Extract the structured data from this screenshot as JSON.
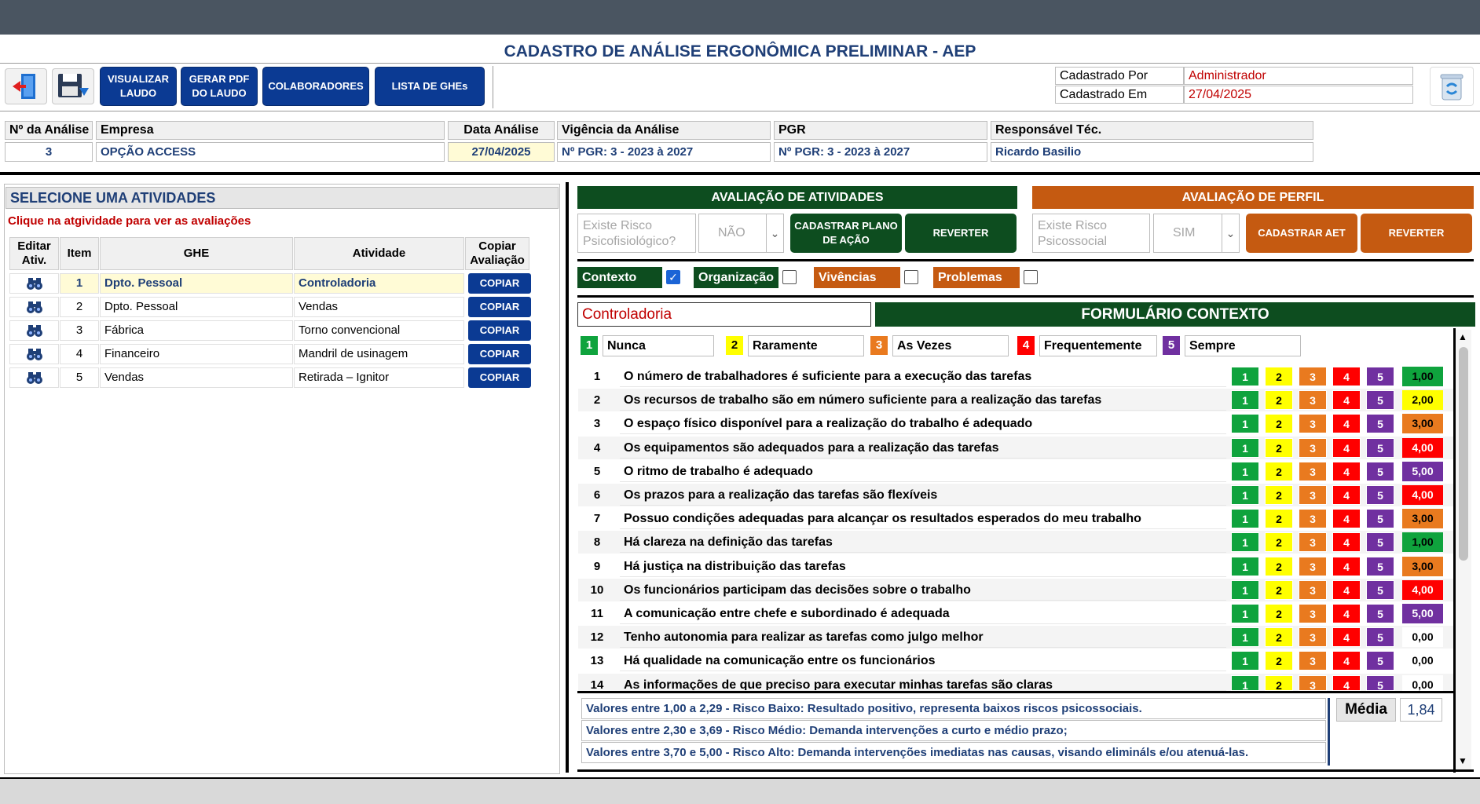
{
  "form_title": "CADASTRO DE ANÁLISE ERGONÔMICA PRELIMINAR - AEP",
  "toolbar": {
    "exit_icon": "exit-door-icon",
    "save_icon": "save-disk-icon",
    "view_report": "VISUALIZAR LAUDO",
    "generate_pdf": "GERAR PDF DO LAUDO",
    "collaborators": "COLABORADORES",
    "ghe_list": "LISTA DE GHEs",
    "trash_icon": "trash-icon"
  },
  "registration": {
    "by_label": "Cadastrado Por",
    "by_value": "Administrador",
    "on_label": "Cadastrado Em",
    "on_value": "27/04/2025"
  },
  "header": {
    "labels": {
      "analysis_no": "Nº da Análise",
      "company": "Empresa",
      "analysis_date": "Data Análise",
      "validity": "Vigência da Análise",
      "pgr": "PGR",
      "responsible": "Responsável Téc."
    },
    "values": {
      "analysis_no": "3",
      "company": "OPÇÃO ACCESS",
      "analysis_date": "27/04/2025",
      "validity": "Nº PGR: 3 - 2023 à 2027",
      "pgr": "Nº PGR: 3 - 2023 à 2027",
      "responsible": "Ricardo Basilio"
    }
  },
  "activities": {
    "title": "SELECIONE UMA ATIVIDADES",
    "hint": "Clique na atgividade para ver as avaliações",
    "columns": [
      "Editar Ativ.",
      "Item",
      "GHE",
      "Atividade",
      "Copiar Avaliação"
    ],
    "copy_label": "COPIAR",
    "rows": [
      {
        "item": "1",
        "ghe": "Dpto. Pessoal",
        "activity": "Controladoria"
      },
      {
        "item": "2",
        "ghe": "Dpto. Pessoal",
        "activity": "Vendas"
      },
      {
        "item": "3",
        "ghe": "Fábrica",
        "activity": "Torno convencional"
      },
      {
        "item": "4",
        "ghe": "Financeiro",
        "activity": "Mandril de usinagem"
      },
      {
        "item": "5",
        "ghe": "Vendas",
        "activity": "Retirada – Ignitor"
      }
    ]
  },
  "activity_eval": {
    "title": "AVALIAÇÃO DE ATIVIDADES",
    "risk_label": "Existe Risco Psicofisiológico?",
    "risk_value": "NÃO",
    "plan_button": "CADASTRAR PLANO DE AÇÃO",
    "revert_button": "REVERTER"
  },
  "profile_eval": {
    "title": "AVALIAÇÃO DE PERFIL",
    "risk_label": "Existe Risco Psicossocial",
    "risk_value": "SIM",
    "aet_button": "CADASTRAR AET",
    "revert_button": "REVERTER"
  },
  "tabs": [
    {
      "label": "Contexto",
      "checked": true
    },
    {
      "label": "Organização",
      "checked": false
    },
    {
      "label": "Vivências",
      "checked": false
    },
    {
      "label": "Problemas",
      "checked": false
    }
  ],
  "current_activity": "Controladoria",
  "form_title_ctx": "FORMULÁRIO CONTEXTO",
  "scale": [
    {
      "num": "1",
      "label": "Nunca",
      "color": "#0fa33d"
    },
    {
      "num": "2",
      "label": "Raramente",
      "color": "#ffff00"
    },
    {
      "num": "3",
      "label": "As Vezes",
      "color": "#e97a1f"
    },
    {
      "num": "4",
      "label": "Frequentemente",
      "color": "#ff0000"
    },
    {
      "num": "5",
      "label": "Sempre",
      "color": "#7030a0"
    }
  ],
  "questions": [
    {
      "n": "1",
      "text": "O número de trabalhadores é suficiente para a execução das tarefas",
      "score": "1,00"
    },
    {
      "n": "2",
      "text": "Os recursos de trabalho são em número suficiente para a realização das tarefas",
      "score": "2,00"
    },
    {
      "n": "3",
      "text": "O espaço físico disponível para a realização do trabalho é adequado",
      "score": "3,00"
    },
    {
      "n": "4",
      "text": "Os equipamentos são adequados para a realização das tarefas",
      "score": "4,00"
    },
    {
      "n": "5",
      "text": "O ritmo de trabalho é adequado",
      "score": "5,00"
    },
    {
      "n": "6",
      "text": "Os prazos para a realização das tarefas são flexíveis",
      "score": "4,00"
    },
    {
      "n": "7",
      "text": "Possuo condições adequadas para alcançar os resultados esperados do meu trabalho",
      "score": "3,00"
    },
    {
      "n": "8",
      "text": "Há clareza na definição das tarefas",
      "score": "1,00"
    },
    {
      "n": "9",
      "text": "Há justiça na distribuição das tarefas",
      "score": "3,00"
    },
    {
      "n": "10",
      "text": "Os funcionários participam das decisões sobre o trabalho",
      "score": "4,00"
    },
    {
      "n": "11",
      "text": "A comunicação entre chefe e subordinado é adequada",
      "score": "5,00"
    },
    {
      "n": "12",
      "text": "Tenho autonomia para realizar as tarefas como julgo melhor",
      "score": "0,00"
    },
    {
      "n": "13",
      "text": "Há qualidade na comunicação entre os funcionários",
      "score": "0,00"
    },
    {
      "n": "14",
      "text": "As informações de que preciso para executar minhas tarefas são claras",
      "score": "0,00"
    }
  ],
  "info": [
    "Valores entre 1,00 a 2,29  - Risco Baixo: Resultado positivo, representa baixos riscos psicossociais.",
    "Valores entre 2,30 e 3,69 - Risco Médio: Demanda intervenções a curto e médio prazo;",
    "Valores entre 3,70 e 5,00 - Risco Alto: Demanda intervenções imediatas nas causas, visando elimináls e/ou atenuá-las."
  ],
  "media_label": "Média",
  "media_value": "1,84"
}
